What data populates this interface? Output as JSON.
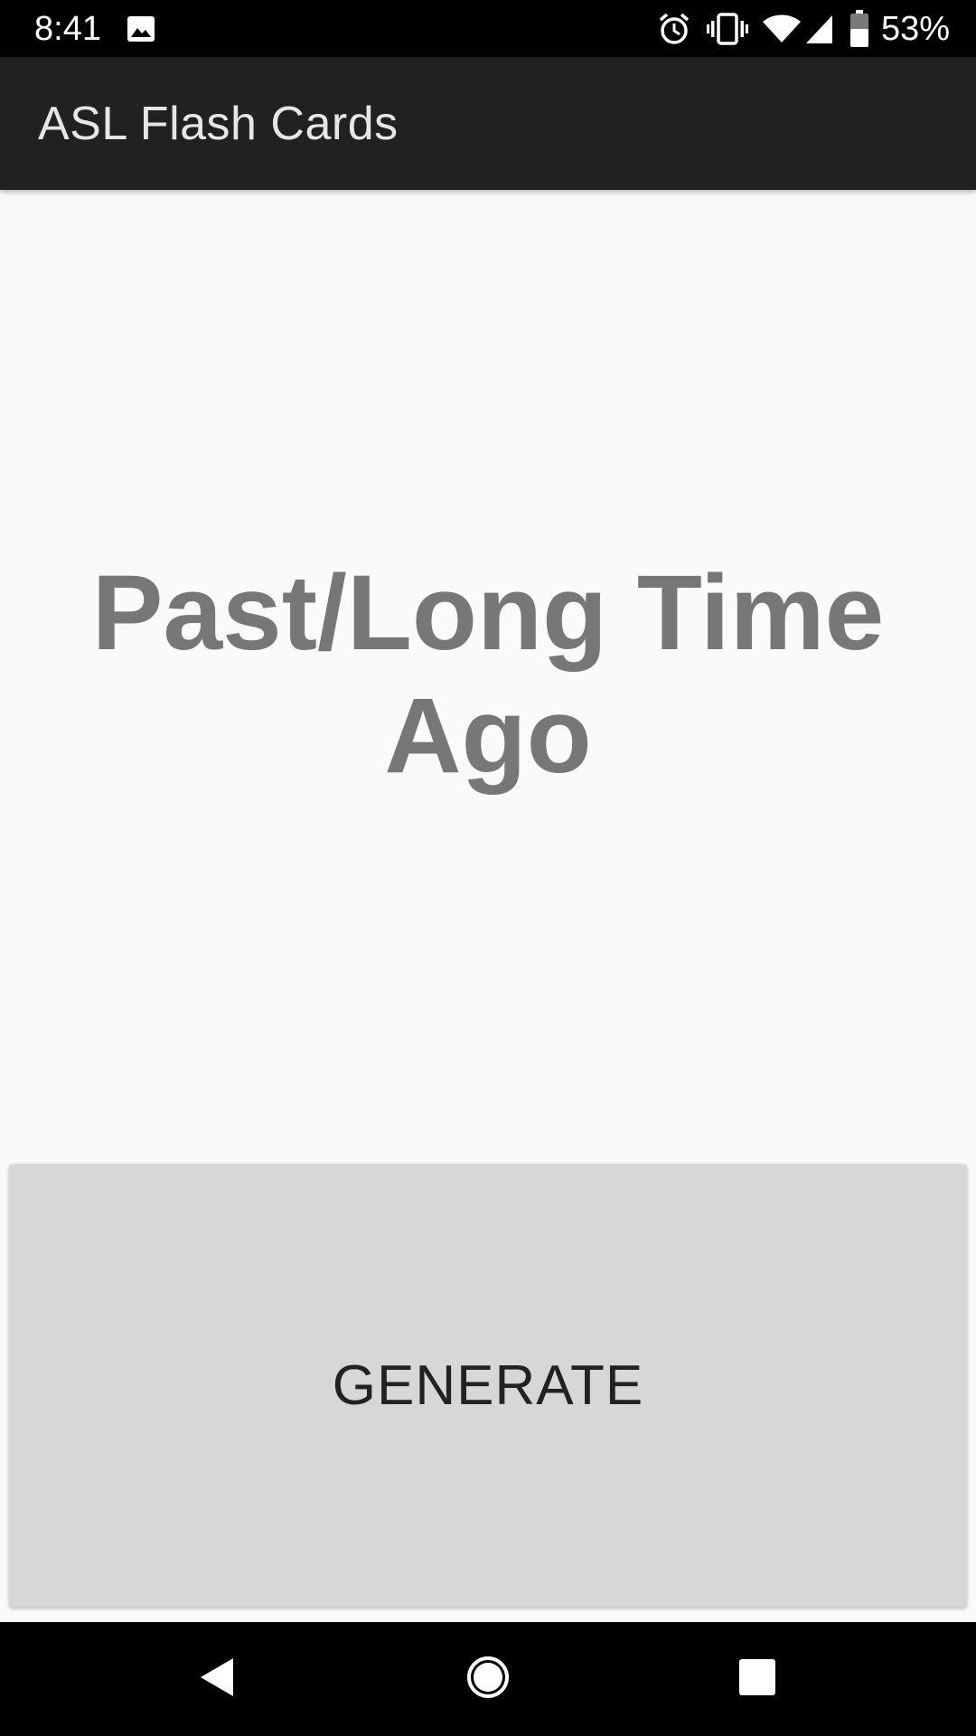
{
  "status_bar": {
    "time": "8:41",
    "battery_percent": "53%",
    "icons": [
      "gallery-icon",
      "alarm-icon",
      "vibrate-icon",
      "wifi-icon",
      "signal-icon",
      "battery-icon"
    ],
    "battery_level": 0.53
  },
  "app_bar": {
    "title": "ASL Flash Cards",
    "background_color": "#212121"
  },
  "card": {
    "word": "Past/Long Time Ago",
    "text_color": "#777777"
  },
  "generate_button": {
    "label": "GENERATE",
    "background_color": "#d6d7d7"
  },
  "nav_bar": {
    "buttons": [
      "back-icon",
      "home-icon",
      "recents-icon"
    ]
  }
}
